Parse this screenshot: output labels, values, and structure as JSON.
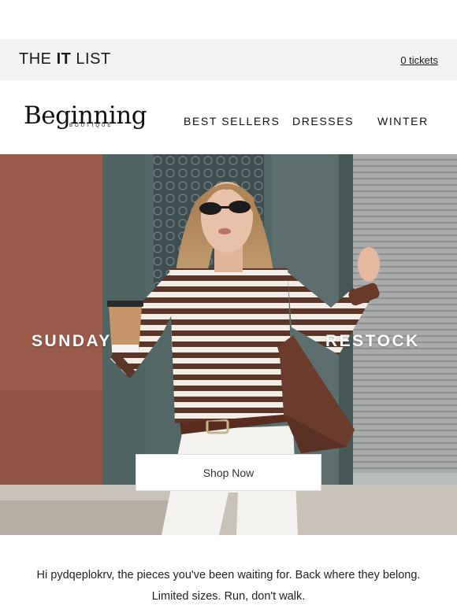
{
  "header": {
    "it_list_prefix": "THE ",
    "it_list_bold": "IT",
    "it_list_suffix": " LIST",
    "tickets_label": "0 tickets"
  },
  "nav": {
    "logo_main": "Beginning",
    "logo_sub": "BOUTIQUE",
    "links": [
      "BEST SELLERS",
      "DRESSES",
      "WINTER"
    ]
  },
  "hero": {
    "left_word": "SUNDAY",
    "right_word": "RESTOCK",
    "cta_label": "Shop Now"
  },
  "message": {
    "line1": "Hi pydqeplokrv, the pieces you've been waiting for. Back where they belong.",
    "line2": "Limited sizes. Run, don't walk."
  },
  "colors": {
    "topbar_bg": "#f3f3f3",
    "stripe_brown": "#5b3526",
    "wall_terracotta": "#9a5a4a",
    "door_teal": "#5c6f6e"
  }
}
